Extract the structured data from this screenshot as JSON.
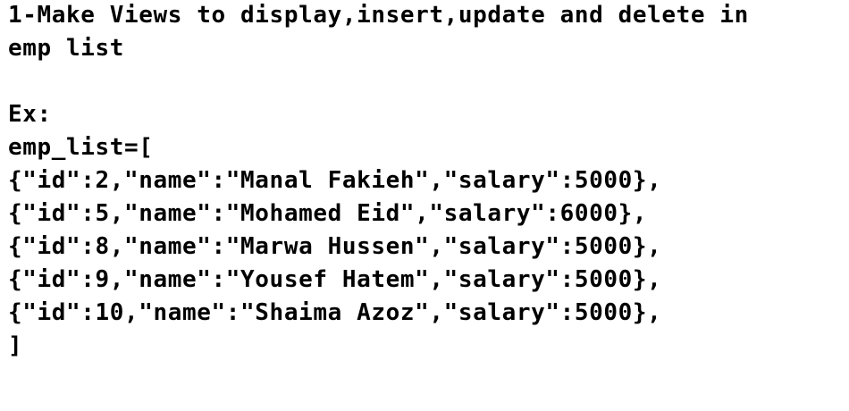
{
  "task": {
    "title_line_1": "1-Make Views to display,insert,update and delete in",
    "title_line_2": "emp list"
  },
  "example": {
    "label": "Ex:",
    "list_open": "emp_list=[",
    "rows": [
      "{\"id\":2,\"name\":\"Manal Fakieh\",\"salary\":5000},",
      "{\"id\":5,\"name\":\"Mohamed Eid\",\"salary\":6000},",
      "{\"id\":8,\"name\":\"Marwa Hussen\",\"salary\":5000},",
      "{\"id\":9,\"name\":\"Yousef Hatem\",\"salary\":5000},",
      "{\"id\":10,\"name\":\"Shaima Azoz\",\"salary\":5000},"
    ],
    "list_close": "]"
  }
}
